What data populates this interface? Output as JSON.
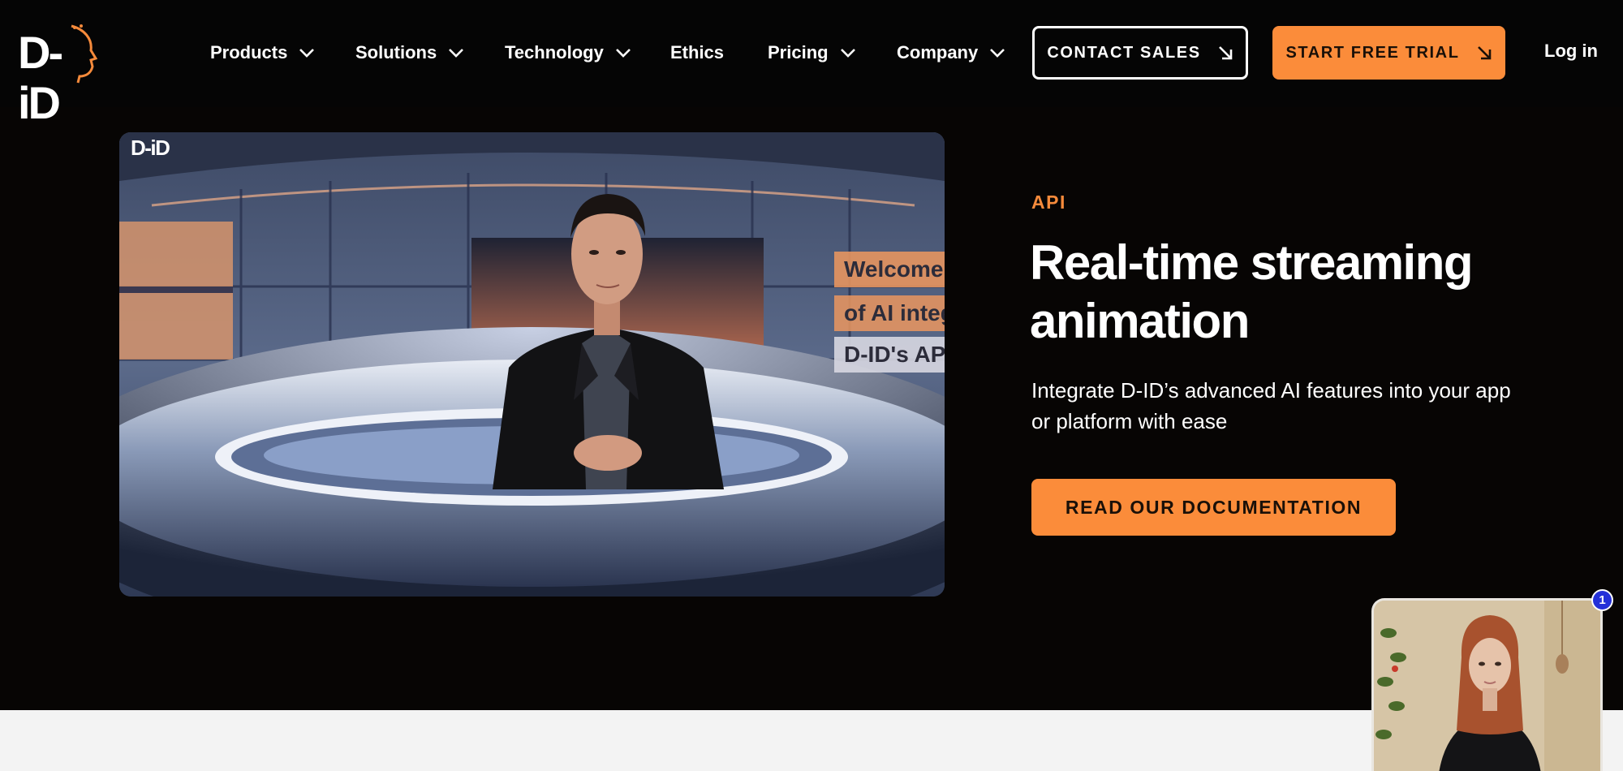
{
  "brand": {
    "logo_text": "D-iD",
    "accent": "#fb8c3a"
  },
  "nav": {
    "items": [
      {
        "label": "Products",
        "has_dropdown": true
      },
      {
        "label": "Solutions",
        "has_dropdown": true
      },
      {
        "label": "Technology",
        "has_dropdown": true
      },
      {
        "label": "Ethics",
        "has_dropdown": false
      },
      {
        "label": "Pricing",
        "has_dropdown": true
      },
      {
        "label": "Company",
        "has_dropdown": true
      }
    ],
    "contact_sales": "CONTACT SALES",
    "start_trial": "START FREE TRIAL",
    "login": "Log in"
  },
  "hero": {
    "video": {
      "watermark": "D-iD",
      "captions": [
        "Welcome",
        "of AI integ",
        "D-ID's API"
      ]
    },
    "eyebrow": "API",
    "title": "Real-time streaming animation",
    "description": "Integrate D-ID’s advanced AI features into your app or platform with ease",
    "cta": "READ OUR DOCUMENTATION"
  },
  "widget": {
    "badge_count": "1"
  },
  "icons": {
    "dropdown": "chevron-down-icon",
    "external": "arrow-down-right-icon"
  }
}
